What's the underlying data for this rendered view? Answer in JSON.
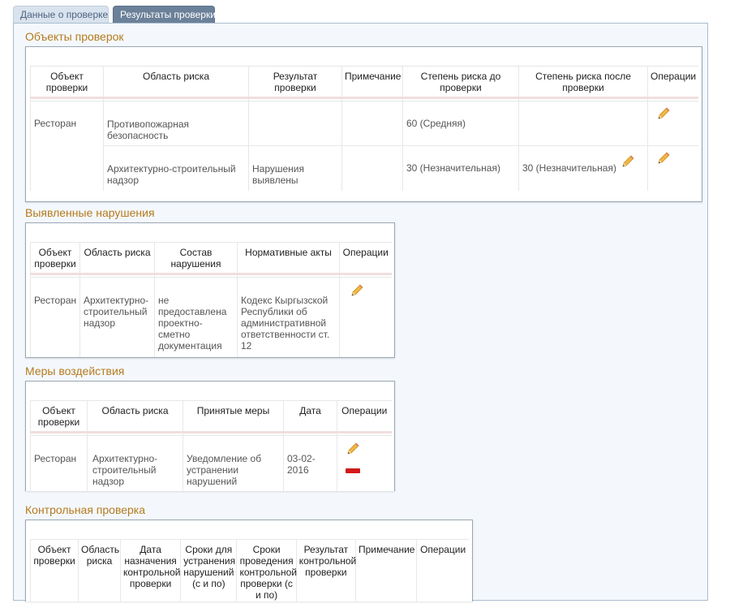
{
  "tabs": [
    {
      "label": "Данные о проверке"
    },
    {
      "label": "Результаты проверки"
    }
  ],
  "sections": {
    "objects": {
      "title": "Объекты проверок",
      "headers": [
        "Объект проверки",
        "Область риска",
        "Результат проверки",
        "Примечание",
        "Степень риска до проверки",
        "Степень риска после проверки",
        "Операции"
      ],
      "rows": [
        {
          "object": "Ресторан",
          "area": "Противопожарная безопасность",
          "result": "",
          "note": "",
          "risk_before": "60 (Средняя)",
          "risk_after": ""
        },
        {
          "object": "",
          "area": "Архитектурно-строительный надзор",
          "result": "Нарушения выявлены",
          "note": "",
          "risk_before": "30 (Незначительная)",
          "risk_after": "30 (Незначительная)"
        }
      ]
    },
    "violations": {
      "title": "Выявленные нарушения",
      "headers": [
        "Объект проверки",
        "Область риска",
        "Состав нарушения",
        "Нормативные акты",
        "Операции"
      ],
      "rows": [
        {
          "object": "Ресторан",
          "area": "Архитектурно-строительный надзор",
          "composition": "не предоставлена проектно-сметно документация",
          "acts": "Кодекс Кыргызской Республики об административной ответственности ст. 12"
        }
      ]
    },
    "measures": {
      "title": "Меры воздействия",
      "headers": [
        "Объект проверки",
        "Область риска",
        "Принятые меры",
        "Дата",
        "Операции"
      ],
      "rows": [
        {
          "object": "Ресторан",
          "area": "Архитектурно-строительный надзор",
          "measures": "Уведомление об устранении нарушений",
          "date": "03-02-2016"
        }
      ]
    },
    "control": {
      "title": "Контрольная проверка",
      "headers": [
        "Объект проверки",
        "Область риска",
        "Дата назначения контрольной проверки",
        "Сроки для устранения нарушений (с и по)",
        "Сроки проведения контрольной проверки (с и по)",
        "Результат контрольной проверки",
        "Примечание",
        "Операции"
      ]
    }
  },
  "colors": {
    "section_title": "#b57a1e",
    "panel_bg": "#f4f8fc",
    "active_tab": "#6b8099",
    "inactive_tab": "#d9e3ee",
    "delete_icon": "#d11a1a",
    "pencil": "#e8a33a"
  },
  "icons": {
    "edit": "pencil-icon",
    "delete": "minus-icon"
  }
}
